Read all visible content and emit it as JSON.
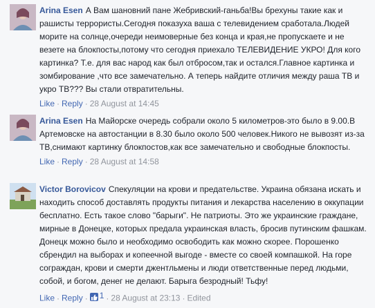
{
  "comments": [
    {
      "author": "Arina Esen",
      "text": "А Вам шановний пане Жебривский-ганьба!Вы брехуны такие как и рашисты террористы.Сегодня показуха ваша с телевидением сработала.Людей морите на солнце,очереди неимоверные без конца и края,не пропускаете и не везете на блокпосты,потому что сегодня приехало ТЕЛЕВИДЕНИЕ УКРО! Для кого картинка? Т.е. для вас народ как был отбросом,так и остался.Главное картинка и зомбирование ,что все замечательно. А теперь найдите отличия между раша ТВ и укро ТВ??? Вы стали отвратительны.",
      "like": "Like",
      "reply": "Reply",
      "time": "28 August at 14:45"
    },
    {
      "author": "Arina Esen",
      "text": "На Майорске очередь собрали около 5 километров-это было в 9.00.В Артемовске на автостанции в 8.30 было около 500 человек.Никого не вывозят из-за ТВ,снимают картинку блокпостов,как все замечательно и свободные блокпосты.",
      "like": "Like",
      "reply": "Reply",
      "time": "28 August at 14:58"
    },
    {
      "author": "Victor Borovicov",
      "text": "Спекуляции на крови и предательстве. Украина обязана искать и находить способ доставлять продукты питания и лекарства населению в оккупации бесплатно. Есть такое слово \"барыги\". Не патриоты. Это же украинские граждане, мирные в Донецке, которых предала украинская власть, бросив путинским фашкам. Донецк можно было и необходимо освободить как можно скорее. Порошенко сбрендил на выборах и копеечной выгоде - вместе со своей компашкой. На горе сограждан, крови и смерти джентльмены и люди ответственные перед людьми, собой, и богом, денег не делают. Барыга безродный! Тьфу!",
      "like": "Like",
      "reply": "Reply",
      "like_count": "1",
      "time": "28 August at 23:13",
      "edited": "Edited"
    }
  ],
  "icons": {
    "like_badge": "thumbs-up-icon"
  },
  "colors": {
    "author": "#365899",
    "link": "#4267b2",
    "meta": "#90949c",
    "background": "#f6f7f9"
  }
}
